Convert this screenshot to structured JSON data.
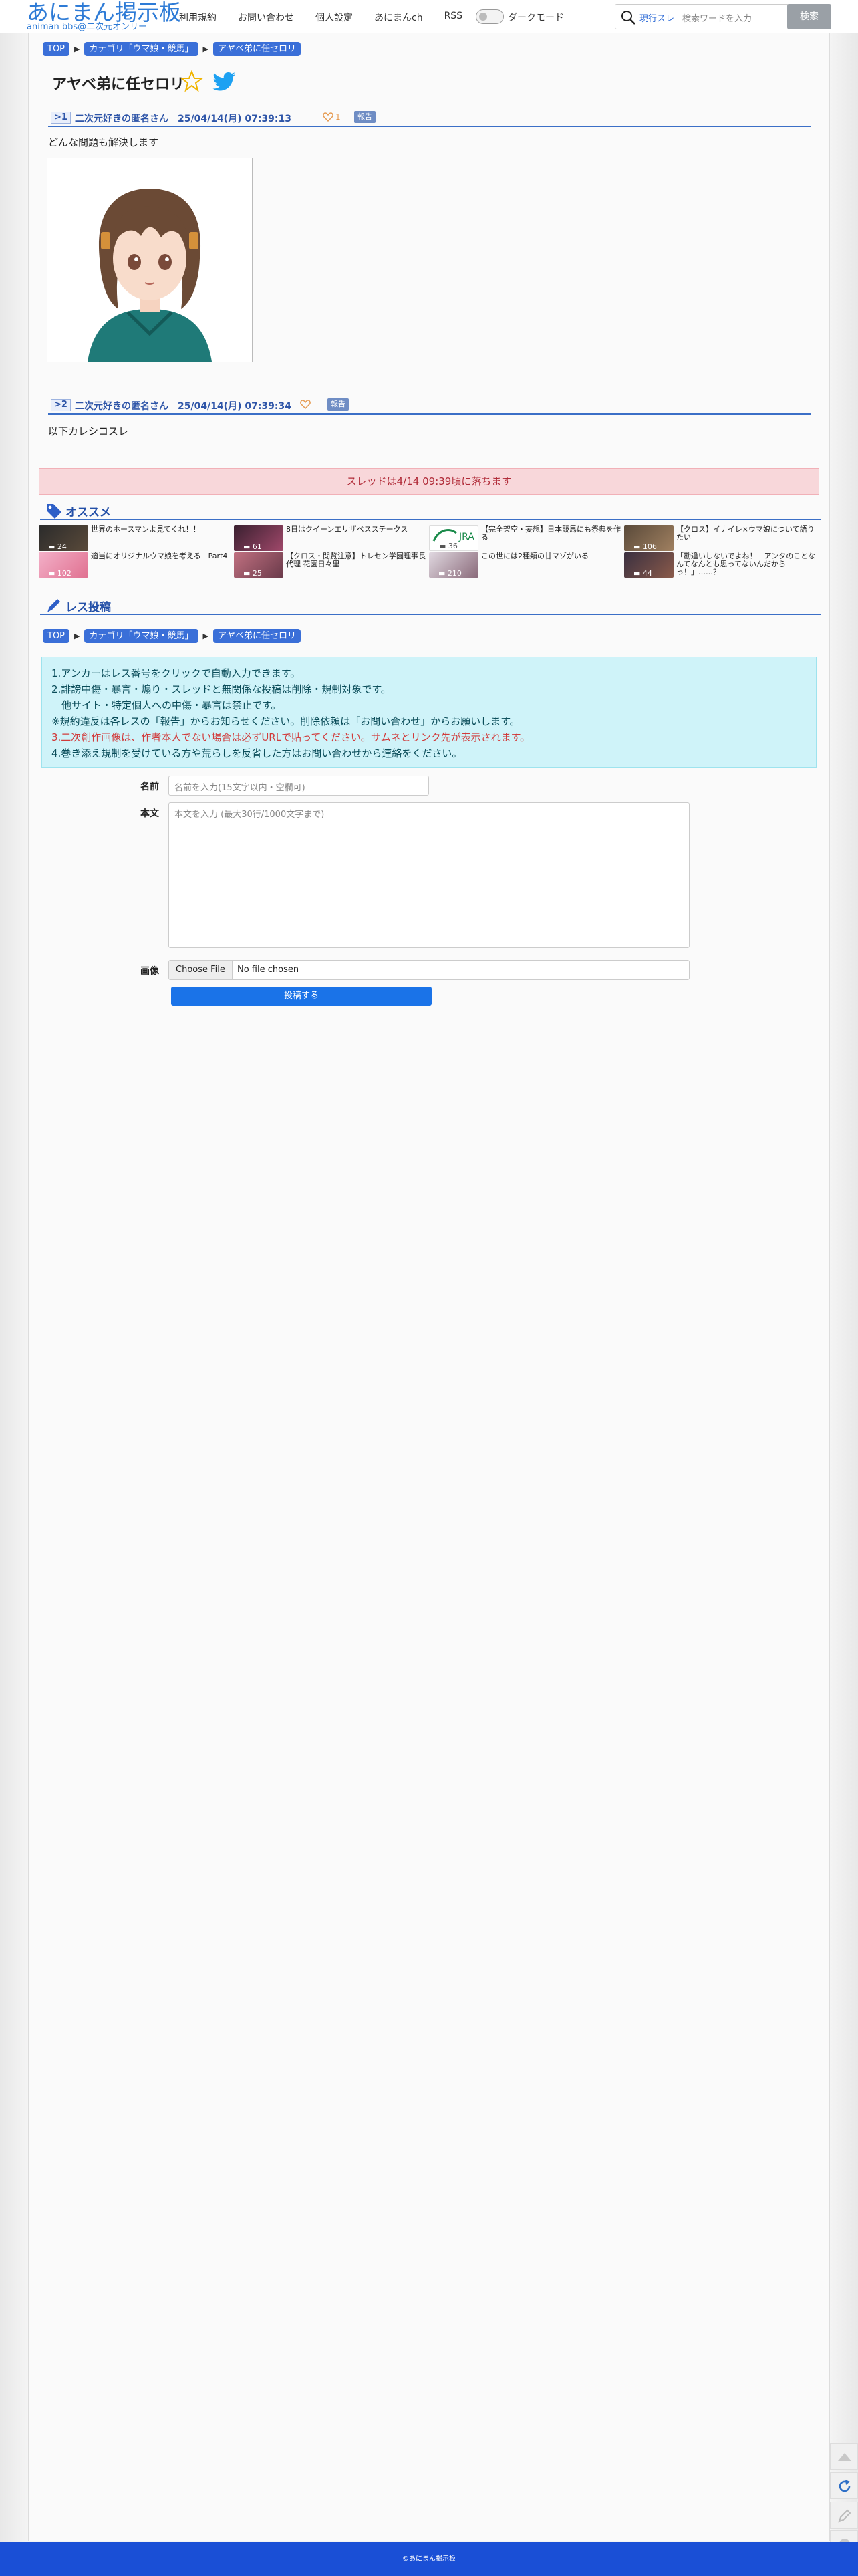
{
  "header": {
    "logo_title": "あにまん掲示板",
    "logo_sub": "animan bbs@二次元オンリー",
    "nav": [
      "利用規約",
      "お問い合わせ",
      "個人設定",
      "あにまんch",
      "RSS"
    ],
    "dark_mode_label": "ダークモード",
    "search_scope": "現行スレ",
    "search_placeholder": "検索ワードを入力",
    "search_button": "検索"
  },
  "breadcrumbs": [
    "TOP",
    "カテゴリ「ウマ娘・競馬」",
    "アヤベ弟に任セロリ"
  ],
  "thread": {
    "title": "アヤベ弟に任セロリ"
  },
  "posts": [
    {
      "num": ">1",
      "header": "二次元好きの匿名さん　25/04/14(月) 07:39:13",
      "likes": "1",
      "report": "報告",
      "body": "どんな問題も解決します"
    },
    {
      "num": ">2",
      "header": "二次元好きの匿名さん　25/04/14(月) 07:39:34",
      "likes": "",
      "report": "報告",
      "body": "以下カレシコスレ"
    }
  ],
  "expire_notice": "スレッドは4/14 09:39頃に落ちます",
  "recommend": {
    "label": "オススメ",
    "items": [
      {
        "title": "世界のホースマンよ見てくれ！！",
        "count": "24"
      },
      {
        "title": "8日はクイーンエリザベスステークス",
        "count": "61"
      },
      {
        "title": "【完全架空・妄想】日本競馬にも祭典を作る",
        "count": "36"
      },
      {
        "title": "【クロス】イナイレ×ウマ娘について語りたい",
        "count": "106"
      },
      {
        "title": "適当にオリジナルウマ娘を考える　Part4",
        "count": "102"
      },
      {
        "title": "【クロス・閲覧注意】トレセン学園理事長代理 花園日々里",
        "count": "25"
      },
      {
        "title": "この世には2種類の甘マゾがいる",
        "count": "210"
      },
      {
        "title": "「勘違いしないでよね！　アンタのことなんてなんとも思ってないんだからっ！」……？",
        "count": "44"
      }
    ]
  },
  "reply": {
    "label": "レス投稿",
    "info": [
      "1.アンカーはレス番号をクリックで自動入力できます。",
      "2.誹謗中傷・暴言・煽り・スレッドと無関係な投稿は削除・規制対象です。",
      "　他サイト・特定個人への中傷・暴言は禁止です。",
      "※規約違反は各レスの「報告」からお知らせください。削除依頼は「お問い合わせ」からお願いします。",
      "3.二次創作画像は、作者本人でない場合は必ずURLで貼ってください。サムネとリンク先が表示されます。",
      "4.巻き添え規制を受けている方や荒らしを反省した方はお問い合わせから連絡をください。"
    ],
    "name_label": "名前",
    "name_placeholder": "名前を入力(15文字以内・空欄可)",
    "body_label": "本文",
    "body_placeholder": "本文を入力 (最大30行/1000文字まで)",
    "image_label": "画像",
    "file_button": "Choose File",
    "file_status": "No file chosen",
    "submit": "投稿する"
  },
  "footer": "©あにまん掲示板",
  "colors": {
    "accent": "#3a6fd8",
    "footer": "#1a4fd6",
    "alert_bg": "#f8d7da",
    "info_bg": "#cff3f9"
  }
}
